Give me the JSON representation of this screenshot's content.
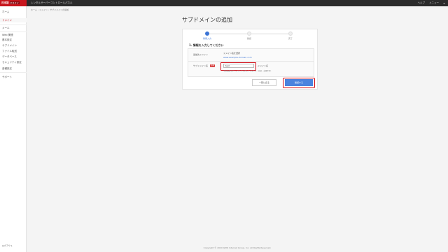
{
  "header": {
    "logo_text": "日本語",
    "logo_badge": "ドメイン",
    "service_name": "レンタルサーバーコントロールパネル",
    "links": [
      "ヘルプ",
      "メニュー",
      "≡"
    ]
  },
  "sidebar": {
    "items": [
      {
        "label": "ホーム",
        "active": false
      },
      {
        "label": "ドメイン",
        "active": true
      },
      {
        "label": "メール",
        "active": false
      },
      {
        "label": "Web 関連",
        "active": false
      },
      {
        "label": "基本設定",
        "active": false
      },
      {
        "label": "サブドメイン",
        "active": false
      },
      {
        "label": "ファイル転送",
        "active": false
      },
      {
        "label": "データベース",
        "active": false
      },
      {
        "label": "セキュリティ設定",
        "active": false
      },
      {
        "label": "各種設定",
        "active": false
      },
      {
        "label": "サポート",
        "active": false
      }
    ],
    "bottom_text": "ログアウト"
  },
  "breadcrumb": "ホーム › ドメイン › サブドメインの追加",
  "page_title": "サブドメインの追加",
  "steps": [
    {
      "label": "情報入力",
      "active": true
    },
    {
      "label": "確認",
      "active": false
    },
    {
      "label": "完了",
      "active": false
    }
  ],
  "section_heading": "1. 情報を入力してください",
  "form": {
    "target_domain_label": "追加先ドメイン",
    "target_domain_value": "ドメイン名を選択",
    "target_domain_link": "www.example-domain.com",
    "subdomain_label": "サブドメイン名",
    "required_badge": "必須",
    "subdomain_value": "test",
    "domain_suffix": ".ドメイン名",
    "hint": "半角英数字とハイフンで入力してください（先頭・末尾不可）"
  },
  "buttons": {
    "back": "一覧に戻る",
    "confirm": "確認する"
  },
  "footer": "Copyright © 2020 GMO Internet Group, Inc. All Rights Reserved.",
  "colors": {
    "brand": "#c8161d",
    "accent": "#4a83de",
    "highlight": "#d2101a"
  }
}
